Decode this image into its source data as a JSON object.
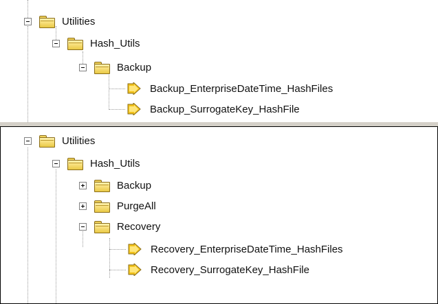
{
  "top_tree": {
    "root": {
      "label": "Utilities",
      "expanded": true,
      "children": [
        {
          "label": "Hash_Utils",
          "expanded": true,
          "children": [
            {
              "label": "Backup",
              "expanded": true,
              "jobs": [
                "Backup_EnterpriseDateTime_HashFiles",
                "Backup_SurrogateKey_HashFile"
              ]
            }
          ]
        }
      ]
    }
  },
  "bottom_tree": {
    "root": {
      "label": "Utilities",
      "expanded": true,
      "children": [
        {
          "label": "Hash_Utils",
          "expanded": true,
          "children": [
            {
              "label": "Backup",
              "expanded": false
            },
            {
              "label": "PurgeAll",
              "expanded": false
            },
            {
              "label": "Recovery",
              "expanded": true,
              "jobs": [
                "Recovery_EnterpriseDateTime_HashFiles",
                "Recovery_SurrogateKey_HashFile"
              ]
            }
          ]
        }
      ]
    }
  },
  "colors": {
    "folder": "#f2d45c",
    "job_icon": "#f2c21a",
    "tree_lines": "#9a9a9a"
  }
}
